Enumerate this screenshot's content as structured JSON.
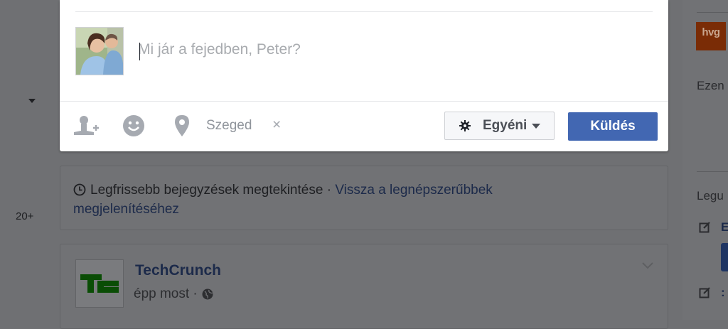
{
  "left_rail": {
    "count": "20+"
  },
  "composer": {
    "placeholder": "Mi jár a fejedben, Peter?",
    "location": "Szeged",
    "clear_glyph": "×",
    "privacy_label": "Egyéni",
    "send_label": "Küldés"
  },
  "notice": {
    "text": "Legfrissebb bejegyzések megtekintése · ",
    "link": "Vissza a legnépszerűbbek megjelenítéséhez"
  },
  "post": {
    "author": "TechCrunch",
    "time": "épp most ·"
  },
  "right_col": {
    "logo_text": "hvg",
    "label_1": "Ezen",
    "label_2": "Legu",
    "item_1": "E",
    "item_2": ":"
  },
  "colors": {
    "brand_blue": "#4267b2",
    "overlay": "#6f7073",
    "techcrunch_green": "#0a9e01"
  },
  "icons": [
    "tag-friends-icon",
    "feeling-icon",
    "location-pin-icon",
    "gear-icon",
    "clock-icon",
    "globe-icon",
    "chevron-down-icon",
    "edit-icon"
  ]
}
